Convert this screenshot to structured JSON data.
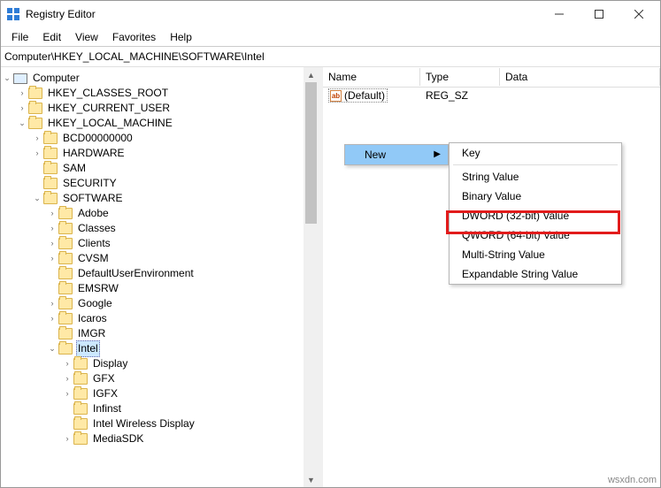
{
  "window": {
    "title": "Registry Editor"
  },
  "menu": {
    "items": [
      "File",
      "Edit",
      "View",
      "Favorites",
      "Help"
    ]
  },
  "address": {
    "path": "Computer\\HKEY_LOCAL_MACHINE\\SOFTWARE\\Intel"
  },
  "tree": {
    "root": "Computer",
    "hives": {
      "hkcr": "HKEY_CLASSES_ROOT",
      "hkcu": "HKEY_CURRENT_USER",
      "hklm": "HKEY_LOCAL_MACHINE"
    },
    "hklm_children": [
      "BCD00000000",
      "HARDWARE",
      "SAM",
      "SECURITY",
      "SOFTWARE"
    ],
    "software_children": [
      "Adobe",
      "Classes",
      "Clients",
      "CVSM",
      "DefaultUserEnvironment",
      "EMSRW",
      "Google",
      "Icaros",
      "IMGR",
      "Intel"
    ],
    "intel_children": [
      "Display",
      "GFX",
      "IGFX",
      "Infinst",
      "Intel Wireless Display",
      "MediaSDK"
    ]
  },
  "list": {
    "headers": {
      "name": "Name",
      "type": "Type",
      "data": "Data"
    },
    "row0": {
      "name": "(Default)",
      "type": "REG_SZ",
      "ab": "ab"
    }
  },
  "context": {
    "new": "New",
    "sub": {
      "key": "Key",
      "string": "String Value",
      "binary": "Binary Value",
      "dword": "DWORD (32-bit) Value",
      "qword": "QWORD (64-bit) Value",
      "multi": "Multi-String Value",
      "expand": "Expandable String Value"
    }
  },
  "watermark": "wsxdn.com"
}
